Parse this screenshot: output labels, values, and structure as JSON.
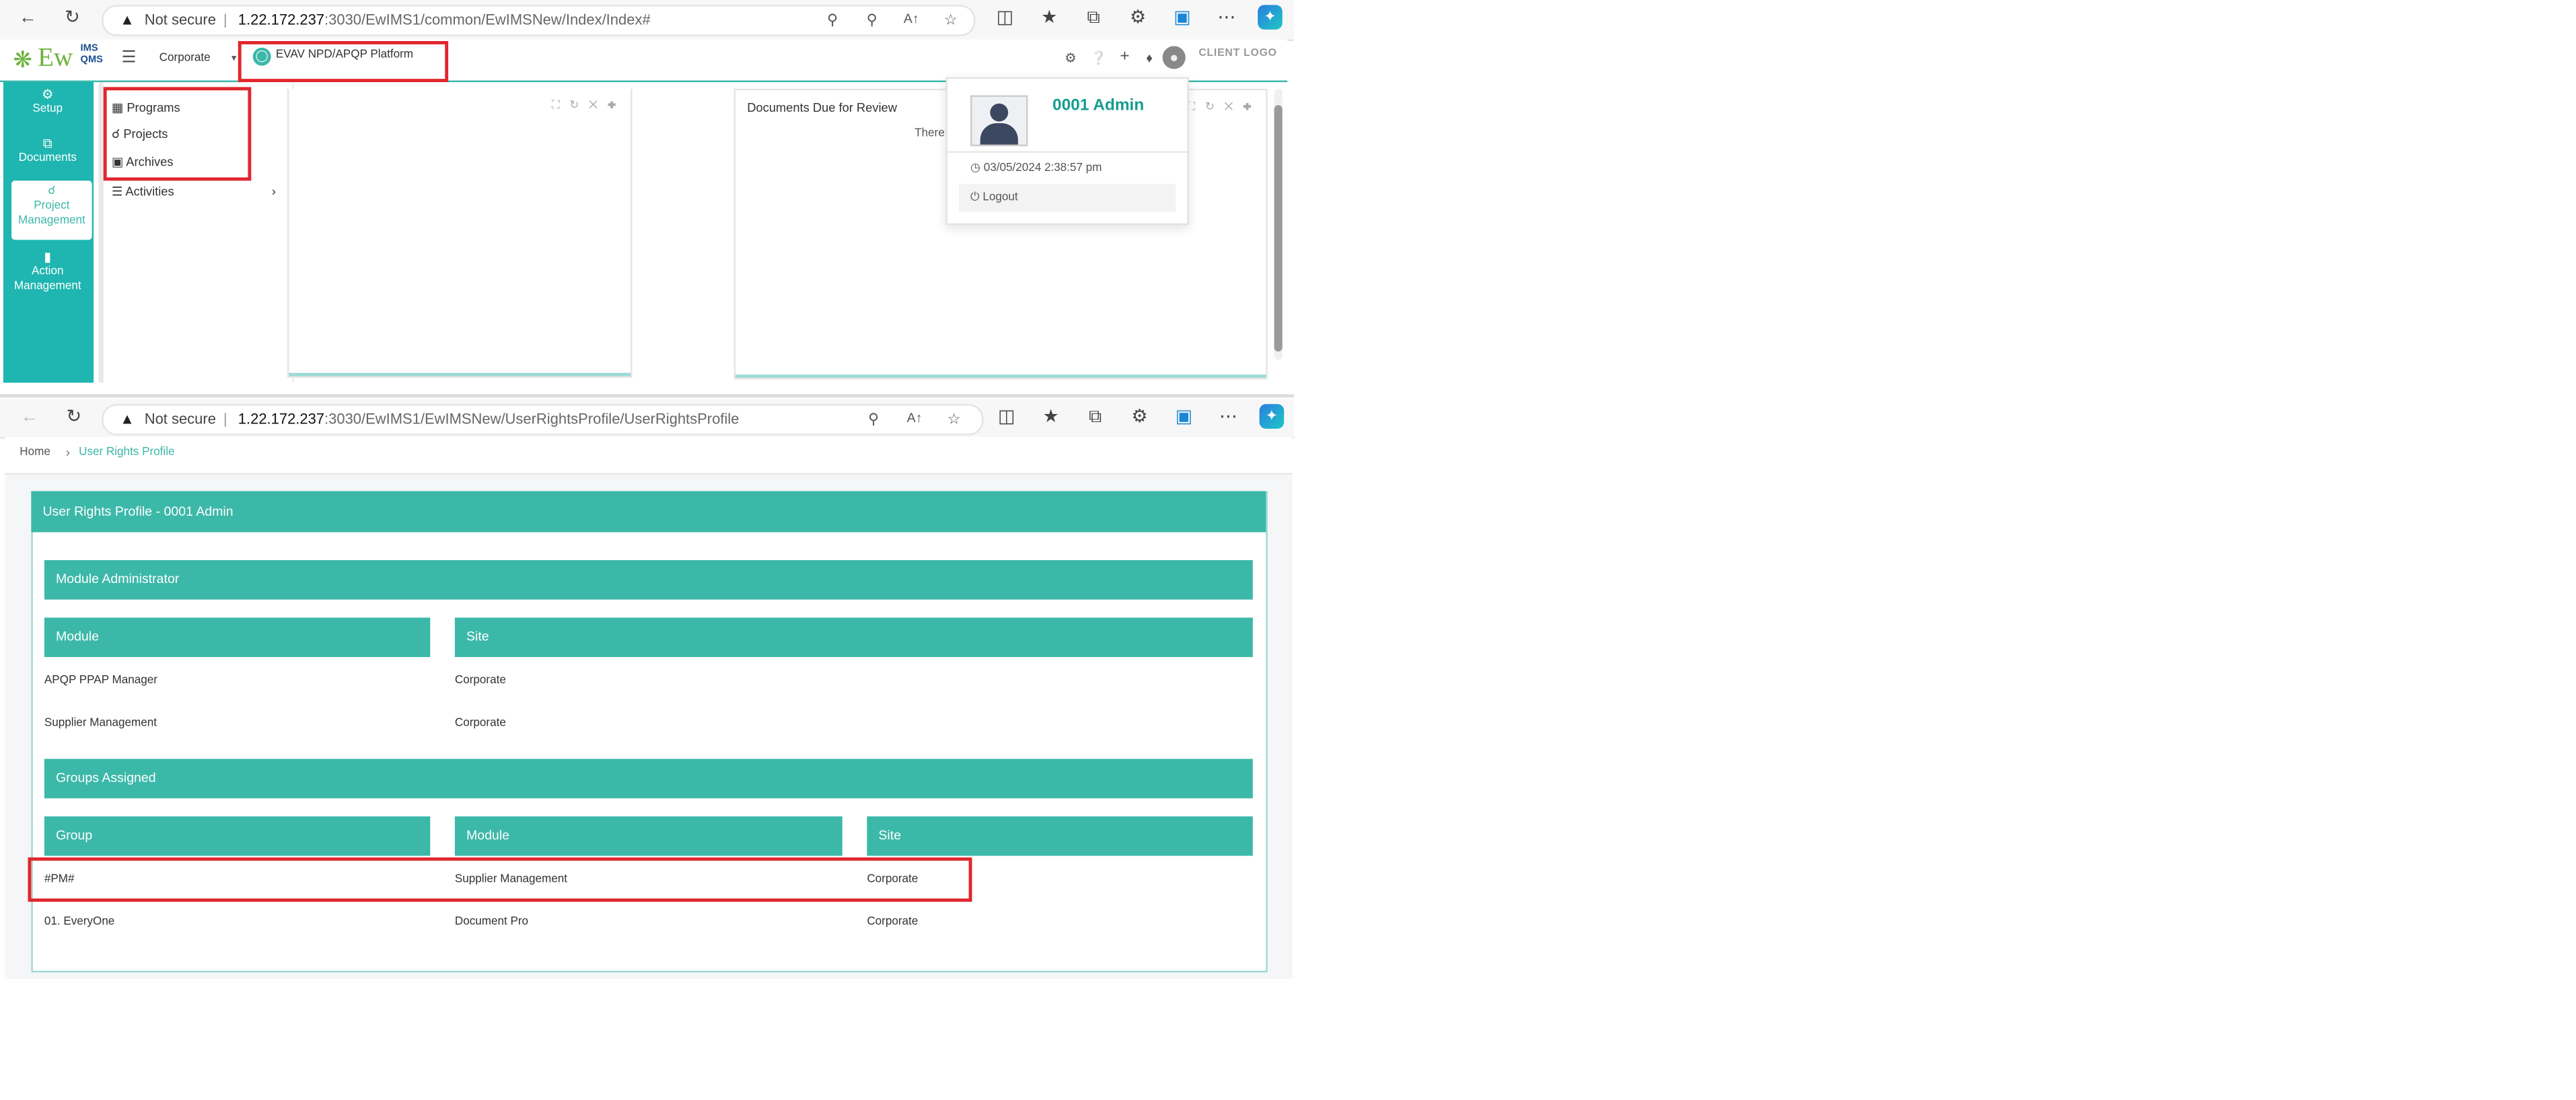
{
  "top_browser": {
    "security_text": "Not secure",
    "url_host": "1.22.172.237",
    "url_path": ":3030/EwIMS1/common/EwIMSNew/Index/Index#"
  },
  "app_header": {
    "logo_text": "Ew",
    "logo_sub_top": "IMS",
    "logo_sub_bottom": "QMS",
    "site_selector": "Corporate",
    "platform_button": "EVAV NPD/APQP Platform",
    "client_logo": "CLIENT LOGO"
  },
  "sidebar": {
    "items": [
      {
        "label": "Setup"
      },
      {
        "label": "Documents"
      },
      {
        "label": "Project Management"
      },
      {
        "label": "Action Management"
      }
    ]
  },
  "submenu": {
    "items": [
      {
        "label": "Programs"
      },
      {
        "label": "Projects"
      },
      {
        "label": "Archives"
      },
      {
        "label": "Activities"
      }
    ]
  },
  "dashboard": {
    "docs_due_title": "Documents Due for Review",
    "docs_due_text": "There"
  },
  "user_dropdown": {
    "name": "0001 Admin",
    "timestamp": "03/05/2024 2:38:57 pm",
    "logout": "Logout"
  },
  "bottom_browser": {
    "security_text": "Not secure",
    "url_host": "1.22.172.237",
    "url_path": ":3030/EwIMS1/EwIMSNew/UserRightsProfile/UserRightsProfile"
  },
  "breadcrumb": {
    "home": "Home",
    "current": "User Rights Profile"
  },
  "profile": {
    "title": "User Rights Profile - 0001 Admin",
    "module_admin_header": "Module Administrator",
    "module_col": "Module",
    "site_col": "Site",
    "module_rows": [
      {
        "module": "APQP PPAP Manager",
        "site": "Corporate"
      },
      {
        "module": "Supplier Management",
        "site": "Corporate"
      }
    ],
    "groups_header": "Groups Assigned",
    "group_col": "Group",
    "group_module_col": "Module",
    "group_site_col": "Site",
    "group_rows": [
      {
        "group": "#PM#",
        "module": "Supplier Management",
        "site": "Corporate"
      },
      {
        "group": "01. EveryOne",
        "module": "Document Pro",
        "site": "Corporate"
      }
    ]
  },
  "colors": {
    "accent": "#3cb8a9",
    "highlight_red": "#e0262e",
    "sidebar_teal": "#1fb5b0"
  },
  "icons": [
    "back-icon",
    "refresh-icon",
    "warning-icon",
    "key-icon",
    "zoom-icon",
    "read-aloud-icon",
    "star-icon",
    "split-icon",
    "favorites-icon",
    "collections-icon",
    "extensions-icon",
    "more-icon",
    "copilot-icon",
    "hamburger-icon",
    "gear-icon",
    "help-icon",
    "plus-icon",
    "bell-icon",
    "user-icon",
    "clock-icon",
    "power-icon"
  ]
}
